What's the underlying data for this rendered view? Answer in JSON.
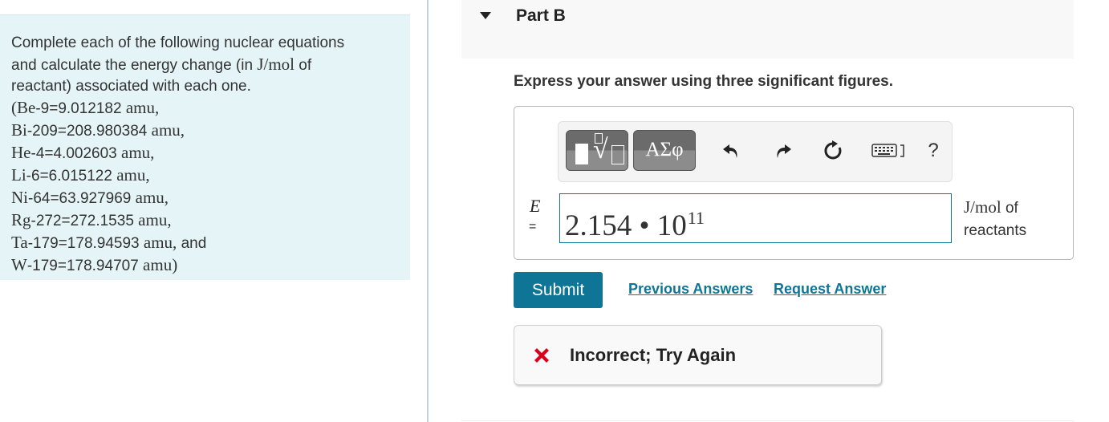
{
  "problem": {
    "intro_line1": "Complete each of the following nuclear equations",
    "intro_line2_prefix": "and calculate the energy change (in ",
    "intro_unit": "J/mol",
    "intro_line2_suffix": " of",
    "intro_line3": "reactant) associated with each one.",
    "masses": [
      {
        "open": "(",
        "sym": "Be",
        "rest": "-9=9.012182 ",
        "unit": "amu,",
        "tail": ""
      },
      {
        "open": "",
        "sym": "Bi",
        "rest": "-209=208.980384 ",
        "unit": "amu,",
        "tail": ""
      },
      {
        "open": "",
        "sym": "He",
        "rest": "-4=4.002603 ",
        "unit": "amu,",
        "tail": ""
      },
      {
        "open": "",
        "sym": "Li",
        "rest": "-6=6.015122 ",
        "unit": "amu,",
        "tail": ""
      },
      {
        "open": "",
        "sym": "Ni",
        "rest": "-64=63.927969 ",
        "unit": "amu,",
        "tail": ""
      },
      {
        "open": "",
        "sym": "Rg",
        "rest": "-272=272.1535 ",
        "unit": "amu,",
        "tail": ""
      },
      {
        "open": "",
        "sym": "Ta",
        "rest": "-179=178.94593 ",
        "unit": "amu,",
        "tail": " and"
      },
      {
        "open": "",
        "sym": "W",
        "rest": "-179=178.94707 ",
        "unit": "amu)",
        "tail": ""
      }
    ]
  },
  "part": {
    "title": "Part B",
    "instruction": "Express your answer using three significant figures."
  },
  "toolbar": {
    "greek_label": "ΑΣφ",
    "help_label": "?"
  },
  "answer": {
    "variable": "E",
    "equals": "=",
    "mantissa": "2.154 • 10",
    "exponent": "11",
    "unit_math": "J/mol",
    "unit_suffix": " of",
    "unit_line2": "reactants"
  },
  "actions": {
    "submit_label": "Submit",
    "previous_answers_label": "Previous Answers",
    "request_answer_label": "Request Answer"
  },
  "feedback": {
    "message": "Incorrect; Try Again",
    "icon": "x-mark-icon",
    "icon_color": "#d9001b"
  },
  "colors": {
    "accent": "#0e7597",
    "panel_bg": "#e5f5f7"
  }
}
